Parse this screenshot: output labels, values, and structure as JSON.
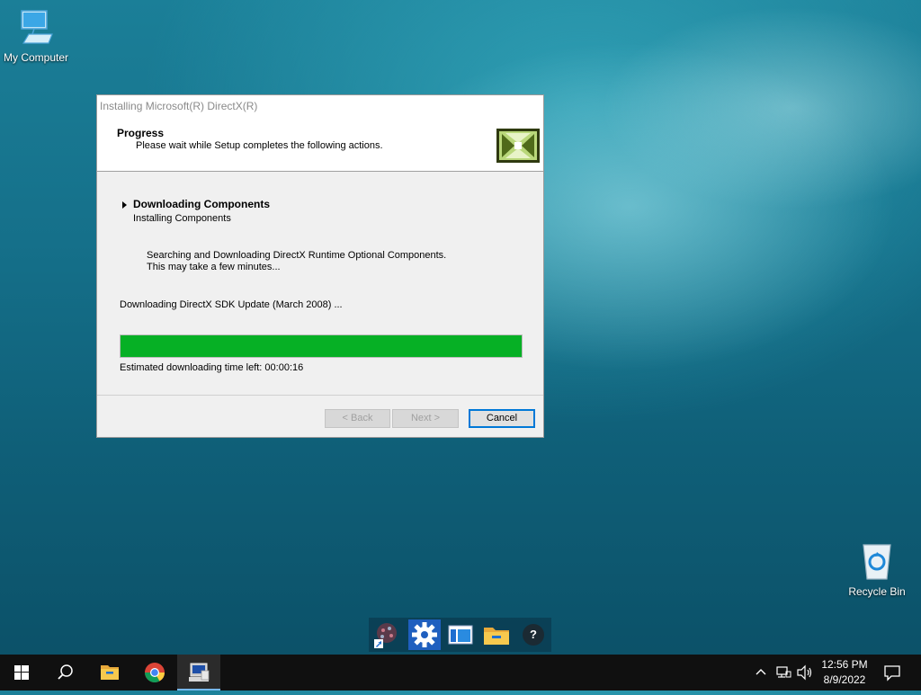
{
  "desktop": {
    "icons": {
      "my_computer": "My Computer",
      "recycle_bin": "Recycle Bin"
    }
  },
  "dialog": {
    "title": "Installing Microsoft(R) DirectX(R)",
    "header_title": "Progress",
    "header_subtitle": "Please wait while Setup completes the following actions.",
    "step_current": "Downloading Components",
    "step_next": "Installing Components",
    "info_line1": "Searching and Downloading DirectX Runtime Optional Components.",
    "info_line2": "This may take a few minutes...",
    "status": "Downloading DirectX SDK Update (March 2008) ...",
    "progress_percent": 100,
    "time_left": "Estimated downloading time left: 00:00:16",
    "buttons": {
      "back": "< Back",
      "next": "Next >",
      "cancel": "Cancel"
    }
  },
  "toolbar": {
    "items": [
      "app-icon",
      "gear-icon",
      "window-icon",
      "folder-icon",
      "help-icon"
    ],
    "help_label": "?"
  },
  "taskbar": {
    "items": [
      "start-icon",
      "search-icon",
      "file-explorer-icon",
      "chrome-icon",
      "setup-icon"
    ],
    "time": "12:56 PM",
    "date": "8/9/2022"
  },
  "colors": {
    "progress": "#06b025",
    "accent": "#0078d7"
  }
}
